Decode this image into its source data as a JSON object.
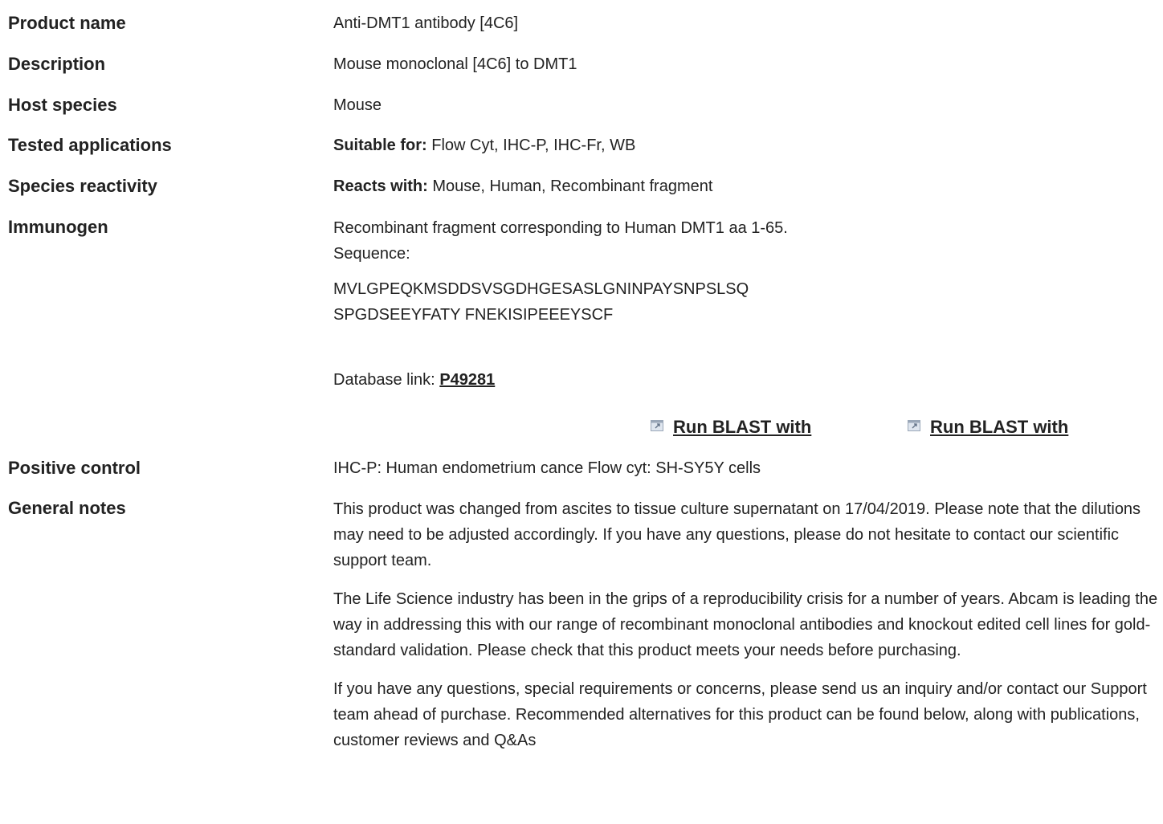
{
  "rows": {
    "product_name": {
      "label": "Product name",
      "value": "Anti-DMT1 antibody [4C6]"
    },
    "description": {
      "label": "Description",
      "value": "Mouse monoclonal [4C6] to DMT1"
    },
    "host_species": {
      "label": "Host species",
      "value": "Mouse"
    },
    "tested_applications": {
      "label": "Tested applications",
      "prefix": "Suitable for:",
      "value": "Flow Cyt, IHC-P, IHC-Fr, WB"
    },
    "species_reactivity": {
      "label": "Species reactivity",
      "prefix": "Reacts with:",
      "value": "Mouse, Human, Recombinant fragment"
    },
    "immunogen": {
      "label": "Immunogen",
      "line1": "Recombinant fragment corresponding to Human DMT1 aa 1-65.",
      "line2": "Sequence:",
      "sequence_line1": "MVLGPEQKMSDDSVSGDHGESASLGNINPAYSNPSLSQ",
      "sequence_line2": "SPGDSEEYFATY FNEKISIPEEEYSCF",
      "db_prefix": "Database link:",
      "db_link": "P49281",
      "blast_link_1": "Run BLAST with",
      "blast_link_2": "Run BLAST with"
    },
    "positive_control": {
      "label": "Positive control",
      "value": "IHC-P: Human endometrium cance Flow cyt: SH-SY5Y cells"
    },
    "general_notes": {
      "label": "General notes",
      "para1": "This product was changed from ascites to tissue culture supernatant on 17/04/2019. Please note that the dilutions may need to be adjusted accordingly. If you have any questions, please do not hesitate to contact our scientific support team.",
      "para2": "The Life Science industry has been in the grips of a reproducibility crisis for a number of years. Abcam is leading the way in addressing this with our range of recombinant monoclonal antibodies and knockout edited cell lines for gold-standard validation. Please check that this product meets your needs before purchasing.",
      "para3": "If you have any questions, special requirements or concerns, please send us an inquiry and/or contact our Support team ahead of purchase. Recommended alternatives for this product can be found below, along with publications, customer reviews and Q&As"
    }
  },
  "icons": {
    "blast": "external-window-icon"
  },
  "colors": {
    "text": "#222222",
    "icon_frame": "#9aa7b8",
    "icon_fill": "#dfe6ef"
  }
}
